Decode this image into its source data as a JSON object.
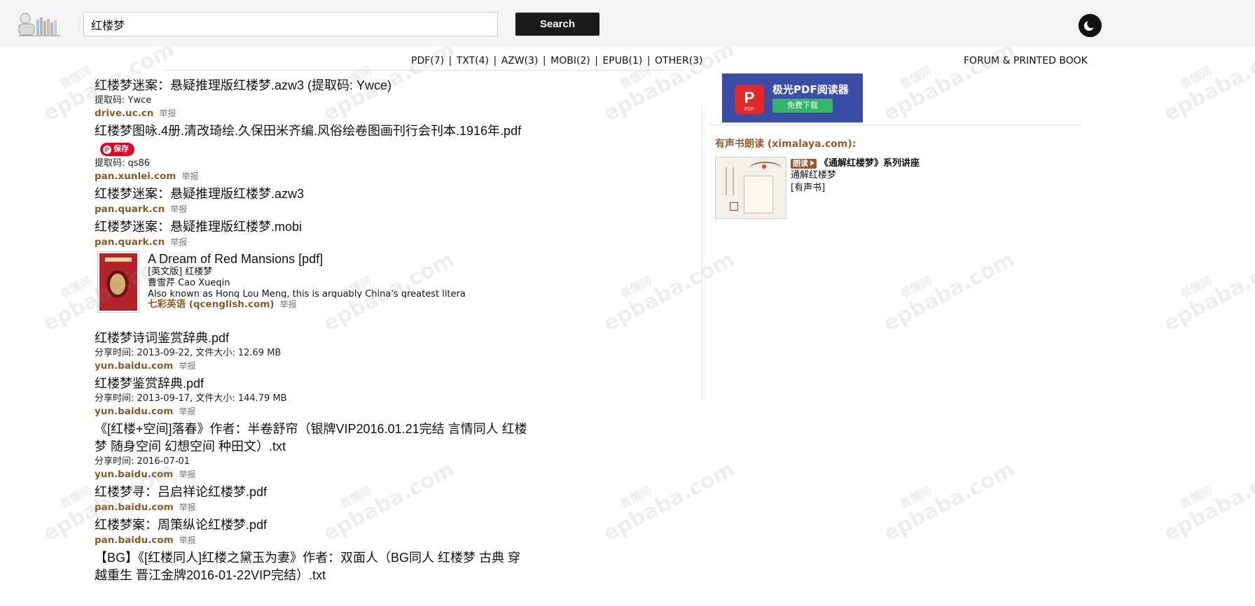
{
  "search": {
    "value": "红楼梦",
    "button_label": "Search"
  },
  "filters": [
    {
      "label": "PDF(7)"
    },
    {
      "label": "TXT(4)"
    },
    {
      "label": "AZW(3)"
    },
    {
      "label": "MOBI(2)"
    },
    {
      "label": "EPUB(1)"
    },
    {
      "label": "OTHER(3)"
    }
  ],
  "forum_link": "FORUM & PRINTED BOOK",
  "report_label": "举报",
  "results": [
    {
      "title": "红楼梦迷案：悬疑推理版红楼梦.azw3 (提取码: Ywce)",
      "meta": "提取码: Ywce",
      "domain": "drive.uc.cn"
    },
    {
      "title": "红楼梦图咏.4册.清改琦绘.久保田米齐编.风俗绘卷图画刊行会刊本.1916年.pdf",
      "save_label": "保存",
      "meta": "提取码: qs86",
      "domain": "pan.xunlei.com"
    },
    {
      "title": "红楼梦迷案：悬疑推理版红楼梦.azw3",
      "domain": "pan.quark.cn"
    },
    {
      "title": "红楼梦迷案：悬疑推理版红楼梦.mobi",
      "domain": "pan.quark.cn"
    }
  ],
  "book": {
    "title": "A Dream of Red Mansions [pdf]",
    "edition": "[英文版] 红楼梦",
    "author": "曹雪芹 Cao Xueqin",
    "description": "Also known as Hong Lou Meng, this is arguably China's greatest litera",
    "source": "七彩英语 (qcenglish.com)"
  },
  "results2": [
    {
      "title": "红楼梦诗词鉴赏辞典.pdf",
      "meta": "分享时间: 2013-09-22, 文件大小: 12.69 MB",
      "domain": "yun.baidu.com"
    },
    {
      "title": "红楼梦鉴赏辞典.pdf",
      "meta": "分享时间: 2013-09-17, 文件大小: 144.79 MB",
      "domain": "yun.baidu.com"
    },
    {
      "title": "《[红楼+空间]落春》作者：半卷舒帘（银牌VIP2016.01.21完结 言情同人 红楼梦 随身空间 幻想空间 种田文）.txt",
      "meta": "分享时间: 2016-07-01",
      "domain": "yun.baidu.com"
    },
    {
      "title": "红楼梦寻：吕启祥论红楼梦.pdf",
      "domain": "pan.baidu.com"
    },
    {
      "title": "红楼梦案：周策纵论红楼梦.pdf",
      "domain": "pan.baidu.com"
    },
    {
      "title": "【BG】《[红楼同人]红楼之黛玉为妻》作者：双面人（BG同人 红楼梦 古典 穿越重生 晋江金牌2016-01-22VIP完结）.txt"
    }
  ],
  "sidebar": {
    "ad": {
      "text": "极光PDF阅读器",
      "button": "免费下载",
      "logo_label": "PDF"
    },
    "audio_heading": "有声书朗读 (ximalaya.com):",
    "audio": {
      "badge": "朗读",
      "title": "《通解红楼梦》系列讲座",
      "subtitle": "通解红楼梦",
      "tag": "[有声书]"
    }
  },
  "watermark": {
    "cn": "看懂网",
    "en": "epbaba.com"
  },
  "colors": {
    "domain": "#8a5a2a",
    "save": "#e60023",
    "ad_bg": "#3a4ea8",
    "topbar": "#f4f4f4"
  },
  "icons": {
    "logo": "book-stack-logo-icon",
    "theme": "moon-icon",
    "pin": "pinterest-icon",
    "play": "play-icon"
  }
}
